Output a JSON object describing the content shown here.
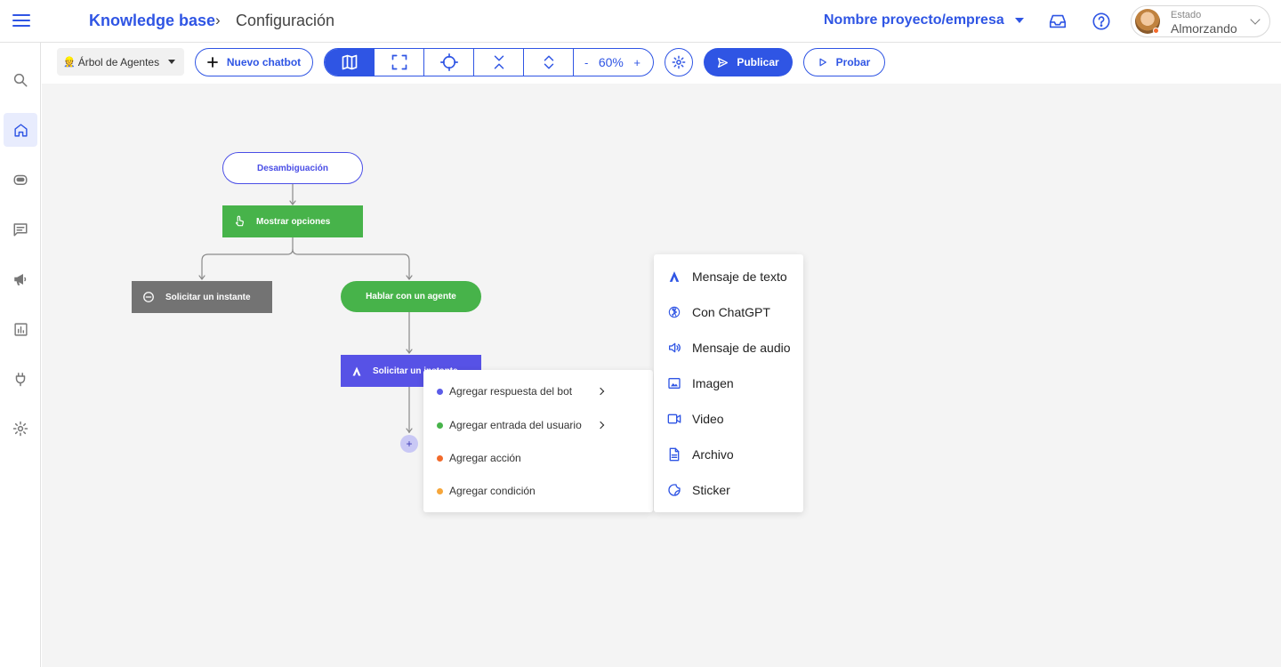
{
  "header": {
    "breadcrumb_root": "Knowledge base",
    "breadcrumb_separator": "›",
    "breadcrumb_current": "Configuración",
    "project_name": "Nombre proyecto/empresa",
    "status_label": "Estado",
    "status_value": "Almorzando"
  },
  "sidebar": {
    "items": [
      {
        "icon": "search-icon"
      },
      {
        "icon": "home-icon",
        "active": true
      },
      {
        "icon": "bot-icon"
      },
      {
        "icon": "chat-icon"
      },
      {
        "icon": "megaphone-icon"
      },
      {
        "icon": "chart-icon"
      },
      {
        "icon": "plug-icon"
      },
      {
        "icon": "settings-icon"
      }
    ]
  },
  "toolbar": {
    "agent_tree_emoji": "👷",
    "agent_tree_label": "Árbol de Agentes",
    "new_chatbot": "Nuevo chatbot",
    "zoom_minus": "-",
    "zoom_value": "60%",
    "zoom_plus": "+",
    "publish": "Publicar",
    "test": "Probar"
  },
  "flow": {
    "nodes": {
      "start": "Desambiguación",
      "options": "Mostrar opciones",
      "wait_left": "Solicitar un instante",
      "talk_agent": "Hablar con un agente",
      "wait_selected": "Solicitar un instante"
    },
    "add_symbol": "+"
  },
  "context_menu": {
    "items": [
      {
        "label": "Agregar respuesta del bot",
        "color": "#5b5ce8",
        "submenu": true
      },
      {
        "label": "Agregar entrada del usuario",
        "color": "#47b34a",
        "submenu": true
      },
      {
        "label": "Agregar acción",
        "color": "#f26a2a",
        "submenu": false
      },
      {
        "label": "Agregar condición",
        "color": "#f6a63a",
        "submenu": false
      }
    ]
  },
  "submenu": {
    "items": [
      {
        "label": "Mensaje de texto",
        "icon": "text-icon"
      },
      {
        "label": "Con ChatGPT",
        "icon": "chatgpt-icon"
      },
      {
        "label": "Mensaje de audio",
        "icon": "audio-icon"
      },
      {
        "label": "Imagen",
        "icon": "image-icon"
      },
      {
        "label": "Video",
        "icon": "video-icon"
      },
      {
        "label": "Archivo",
        "icon": "file-icon"
      },
      {
        "label": "Sticker",
        "icon": "sticker-icon"
      }
    ]
  },
  "colors": {
    "accent": "#2f55e4",
    "node_green": "#47b34a",
    "node_grey": "#737373",
    "node_purple": "#5752e6"
  }
}
